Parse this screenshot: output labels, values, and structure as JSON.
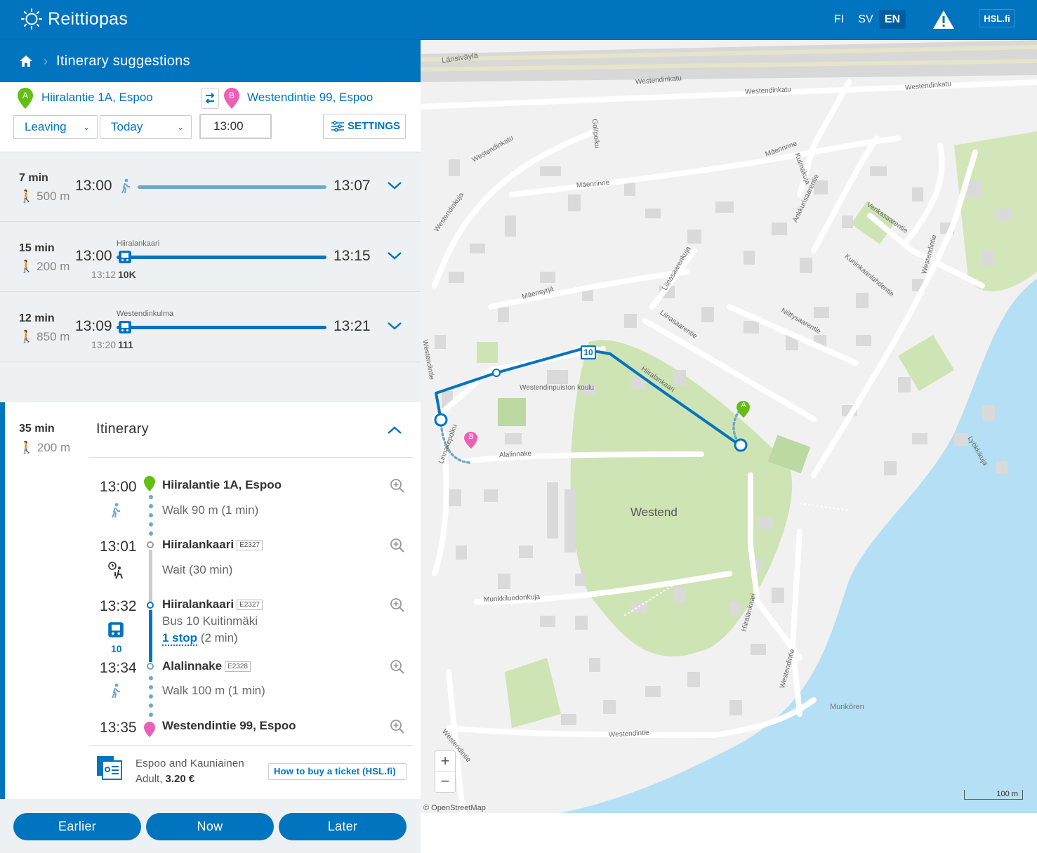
{
  "app": {
    "name": "Reittiopas"
  },
  "header": {
    "languages": [
      "FI",
      "SV",
      "EN"
    ],
    "active_language": "EN",
    "hsl_link": "HSL.fi"
  },
  "breadcrumb": {
    "title": "Itinerary suggestions"
  },
  "search": {
    "from": "Hiiralantie 1A, Espoo",
    "to": "Westendintie 99, Espoo",
    "from_marker": "A",
    "to_marker": "B",
    "mode": "Leaving",
    "day": "Today",
    "time": "13:00",
    "settings_label": "SETTINGS"
  },
  "itineraries": [
    {
      "duration": "7 min",
      "walk": "500 m",
      "start": "13:00",
      "end": "13:07"
    },
    {
      "duration": "15 min",
      "walk": "200 m",
      "start": "13:00",
      "end": "13:15",
      "stop": "Hiiralankaari",
      "departure": "13:12",
      "route": "10K"
    },
    {
      "duration": "12 min",
      "walk": "850 m",
      "start": "13:09",
      "end": "13:21",
      "stop": "Westendinkulma",
      "departure": "13:20",
      "route": "111"
    }
  ],
  "selected": {
    "duration": "35 min",
    "walk": "200 m",
    "heading": "Itinerary",
    "legs": [
      {
        "time": "13:00",
        "name": "Hiiralantie 1A, Espoo",
        "sub": "Walk 90 m (1 min)"
      },
      {
        "time": "13:01",
        "name": "Hiiralankaari",
        "code": "E2327",
        "sub": "Wait (30 min)"
      },
      {
        "time": "13:32",
        "name": "Hiiralankaari",
        "code": "E2327",
        "sub": "Bus 10 Kuitinmäki",
        "stops_link": "1 stop",
        "stops_dur": "(2 min)",
        "route": "10"
      },
      {
        "time": "13:34",
        "name": "Alalinnake",
        "code": "E2328",
        "sub": "Walk 100 m (1 min)"
      },
      {
        "time": "13:35",
        "name": "Westendintie 99, Espoo"
      }
    ],
    "ticket": {
      "zone": "Espoo and Kauniainen",
      "type": "Adult,",
      "price": "3.20 €",
      "buy_label": "How to buy a ticket (HSL.fi)"
    }
  },
  "pager": {
    "earlier": "Earlier",
    "now": "Now",
    "later": "Later"
  },
  "map": {
    "labels": {
      "lansivayla": "Länsiväylä",
      "westendinkatu1": "Westendinkatu",
      "westendinkatu2": "Westendinkatu",
      "westendinkatu3": "Westendinkatu",
      "westendinkatu4": "Westendinkatu",
      "mäenrinne1": "Mäenrinne",
      "mäenrinne2": "Mäenrinne",
      "golfpolku": "Golfpolku",
      "westendinkuja": "Westendinkuja",
      "kulmakuja": "Kulmakuja",
      "ankkurisaarentie": "Ankkurisaarentie",
      "venkasaarentie": "Venkasaarentie",
      "maensyrja": "Mäensyrjä",
      "liinasaarenkuja": "Liinasaarenkuja",
      "liinasaarentie": "Liinasaarentie",
      "niittysaarentie": "Niittysaarentie",
      "kuninkaanlahdentie": "Kuninkaanlahdentie",
      "westendintie_r": "Westendintie",
      "westendintie_l": "Westendintie",
      "hiiralankaari_map": "Hiiralankaari",
      "school": "Westendinpuiston koulu",
      "alalinnake": "Alalinnake",
      "linnakepolku": "Linnakepolku",
      "westend": "Westend",
      "munkkiluodonkuja": "Munkkiluodonkuja",
      "lyokkikuja": "Lyökkikuja",
      "munkoren": "Munkören",
      "westendintie_b1": "Westendintie",
      "westendintie_b2": "Westendintie",
      "westendintie_b3": "Westendintie",
      "hiiralankaari2": "Hiiralankaari"
    },
    "route_badge": "10",
    "scale": "100 m",
    "attribution": "© OpenStreetMap",
    "zoom_in": "+",
    "zoom_out": "−",
    "colors": {
      "route": "#0074bf",
      "water": "#b4dff4",
      "park": "#cfe4b4",
      "walk": "#6fa7c8"
    }
  }
}
